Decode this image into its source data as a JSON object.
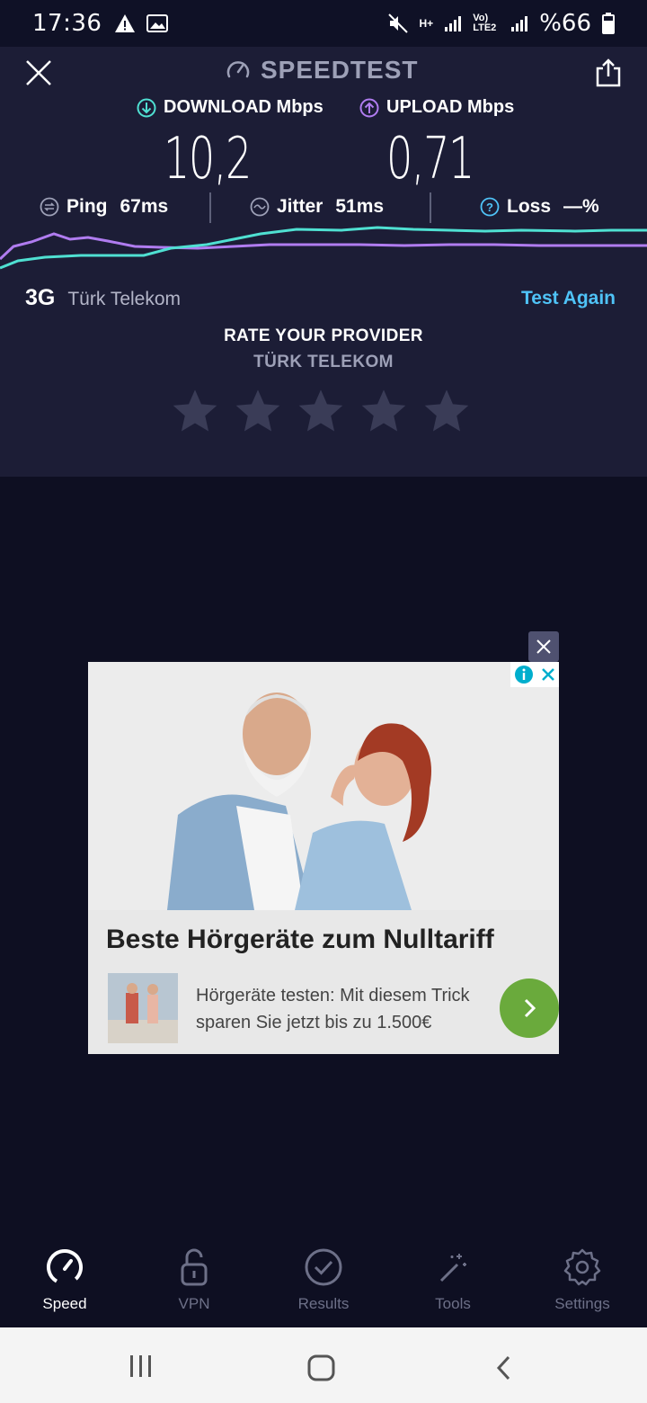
{
  "status_bar": {
    "time": "17:36",
    "battery": "%66",
    "network_labels": [
      "H+",
      "Vo) LTE2"
    ]
  },
  "header": {
    "title": "SPEEDTEST"
  },
  "metrics": {
    "download_label": "DOWNLOAD Mbps",
    "download_value": "10,2",
    "upload_label": "UPLOAD Mbps",
    "upload_value": "0,71",
    "download_color": "#4fe0d2",
    "upload_color": "#b07cf0"
  },
  "stats": {
    "ping_label": "Ping",
    "ping_value": "67ms",
    "jitter_label": "Jitter",
    "jitter_value": "51ms",
    "loss_label": "Loss",
    "loss_value": "—%"
  },
  "network": {
    "type": "3G",
    "provider": "Türk Telekom",
    "test_again": "Test Again"
  },
  "rating": {
    "title": "RATE YOUR PROVIDER",
    "provider": "TÜRK TELEKOM",
    "stars_total": 5,
    "stars_selected": 0
  },
  "ad": {
    "headline": "Beste Hörgeräte zum Nulltariff",
    "body": "Hörgeräte testen: Mit diesem Trick sparen Sie jetzt bis zu 1.500€"
  },
  "bottom_nav": [
    {
      "label": "Speed",
      "icon": "speedometer-icon",
      "active": true
    },
    {
      "label": "VPN",
      "icon": "padlock-icon",
      "active": false
    },
    {
      "label": "Results",
      "icon": "check-circle-icon",
      "active": false
    },
    {
      "label": "Tools",
      "icon": "magic-wand-icon",
      "active": false
    },
    {
      "label": "Settings",
      "icon": "gear-icon",
      "active": false
    }
  ],
  "colors": {
    "accent_blue": "#4fc3f7",
    "panel": "#1c1d36",
    "background": "#0e0f22"
  }
}
